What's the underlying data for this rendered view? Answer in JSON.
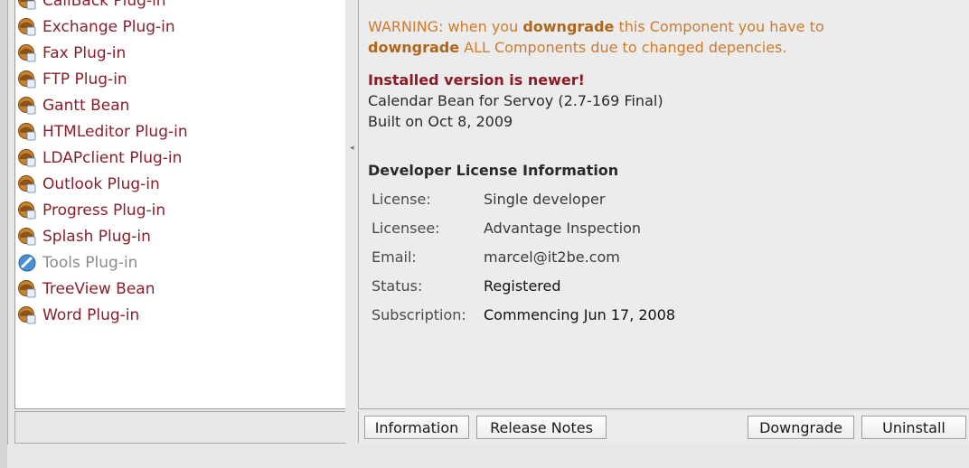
{
  "plugins": [
    {
      "label": "CallBack Plug-in",
      "icon": "plugin-icon",
      "enabled": true
    },
    {
      "label": "Exchange Plug-in",
      "icon": "plugin-icon",
      "enabled": true
    },
    {
      "label": "Fax Plug-in",
      "icon": "plugin-icon",
      "enabled": true
    },
    {
      "label": "FTP Plug-in",
      "icon": "plugin-icon",
      "enabled": true
    },
    {
      "label": "Gantt Bean",
      "icon": "plugin-icon",
      "enabled": true
    },
    {
      "label": "HTMLeditor Plug-in",
      "icon": "plugin-icon",
      "enabled": true
    },
    {
      "label": "LDAPclient Plug-in",
      "icon": "plugin-icon",
      "enabled": true
    },
    {
      "label": "Outlook Plug-in",
      "icon": "plugin-icon",
      "enabled": true
    },
    {
      "label": "Progress Plug-in",
      "icon": "plugin-icon",
      "enabled": true
    },
    {
      "label": "Splash Plug-in",
      "icon": "plugin-icon",
      "enabled": true
    },
    {
      "label": "Tools Plug-in",
      "icon": "tools-plugin-icon",
      "enabled": false
    },
    {
      "label": "TreeView Bean",
      "icon": "plugin-icon",
      "enabled": true
    },
    {
      "label": "Word Plug-in",
      "icon": "plugin-icon",
      "enabled": true
    }
  ],
  "detail": {
    "warning_1": "WARNING: when you ",
    "warning_bold_1": "downgrade",
    "warning_2": " this Component you have to",
    "warning_bold_2": "downgrade",
    "warning_3": " ALL Components due to changed depencies.",
    "installed_title": "Installed version is newer!",
    "component_name": "Calendar Bean for Servoy (2.7-169 Final)",
    "built_on": "Built on Oct 8, 2009",
    "license_section_title": "Developer License Information",
    "license": {
      "license_label": "License:",
      "license_value": "Single developer",
      "licensee_label": "Licensee:",
      "licensee_value": "Advantage Inspection",
      "email_label": "Email:",
      "email_value": "marcel@it2be.com",
      "status_label": "Status:",
      "status_value": "Registered",
      "subscription_label": "Subscription:",
      "subscription_value": "Commencing Jun 17, 2008"
    }
  },
  "buttons": {
    "information": "Information",
    "release_notes": "Release Notes",
    "downgrade": "Downgrade",
    "uninstall": "Uninstall"
  },
  "colors": {
    "enabled_text": "#8a1f2b",
    "disabled_text": "#8c8c8c",
    "warning": "#d07a2a",
    "installed_title": "#8c1b25"
  }
}
